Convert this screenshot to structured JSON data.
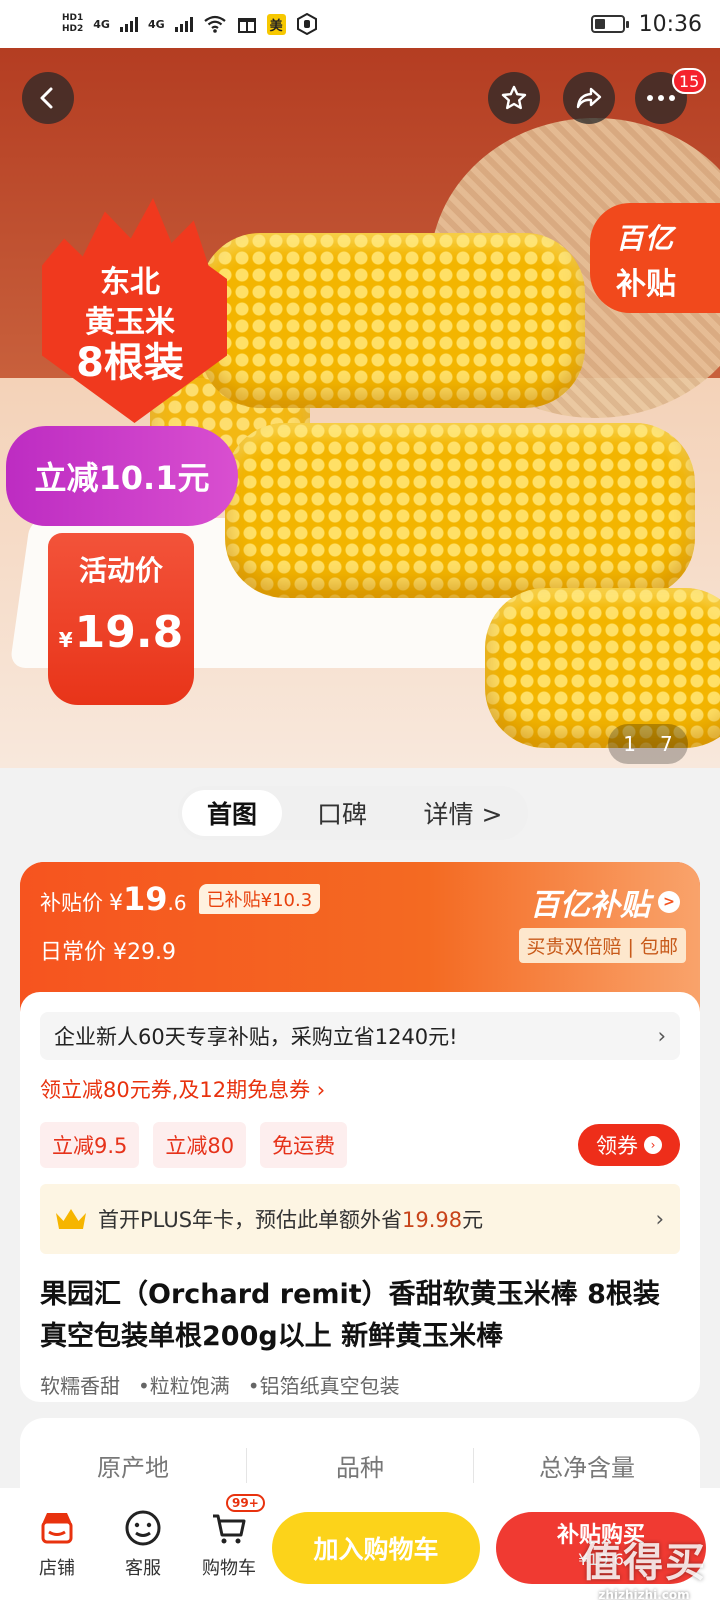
{
  "status_bar": {
    "hd1": "HD1",
    "hd2": "HD2",
    "net1": "4G",
    "net2": "4G",
    "mei": "美",
    "time": "10:36"
  },
  "hero": {
    "more_badge": "15",
    "subsidy_line1": "百亿",
    "subsidy_line2": "补贴",
    "flame_line1": "东北",
    "flame_line2": "黄玉米",
    "flame_line3": "8根装",
    "reduce_text": "立减10.1元",
    "activity_label": "活动价",
    "activity_yen": "¥",
    "activity_price": "19.8",
    "counter_current": "1",
    "counter_total": "7"
  },
  "tabs": [
    "首图",
    "口碑",
    "详情 >"
  ],
  "price": {
    "subsidy_label": "补贴价",
    "yen": "¥",
    "subsidy_int": "19",
    "subsidy_dec": ".6",
    "already_subsidy": "已补贴¥10.3",
    "regular_label": "日常价",
    "regular_price": "¥29.9",
    "brand": "百亿补贴",
    "brand_arrow": ">",
    "guarantee": "买贵双倍赔 | 包邮"
  },
  "promo": {
    "enterprise": "企业新人60天专享补贴，采购立省1240元!",
    "enterprise_arrow": "›",
    "coupon_link": "领立减80元券,及12期免息券 ›",
    "tags": [
      "立减9.5",
      "立减80",
      "免运费"
    ],
    "claim": "领券",
    "claim_arrow": "›",
    "plus_text": "首开PLUS年卡，预估此单额外省",
    "plus_amount": "19.98",
    "plus_unit": "元",
    "plus_arrow": "›"
  },
  "product": {
    "title": "果园汇（Orchard remit）香甜软黄玉米棒 8根装真空包装单根200g以上 新鲜黄玉米棒",
    "features": [
      "软糯香甜",
      "•粒粒饱满",
      "•铝箔纸真空包装"
    ]
  },
  "spec_headers": [
    "原产地",
    "品种",
    "总净含量"
  ],
  "bottom": {
    "shop": "店铺",
    "service": "客服",
    "cart": "购物车",
    "cart_badge": "99+",
    "add_cart": "加入购物车",
    "buy_line1": "补贴购买",
    "buy_line2": "¥19.6"
  },
  "watermark": {
    "line1": "值得买",
    "line2": "zhizhizhi.com"
  },
  "colors": {
    "accent": "#f0391e",
    "subsidy_orange": "#f6541f",
    "cart_yellow": "#fcd31a",
    "buy_red": "#f03a32"
  }
}
